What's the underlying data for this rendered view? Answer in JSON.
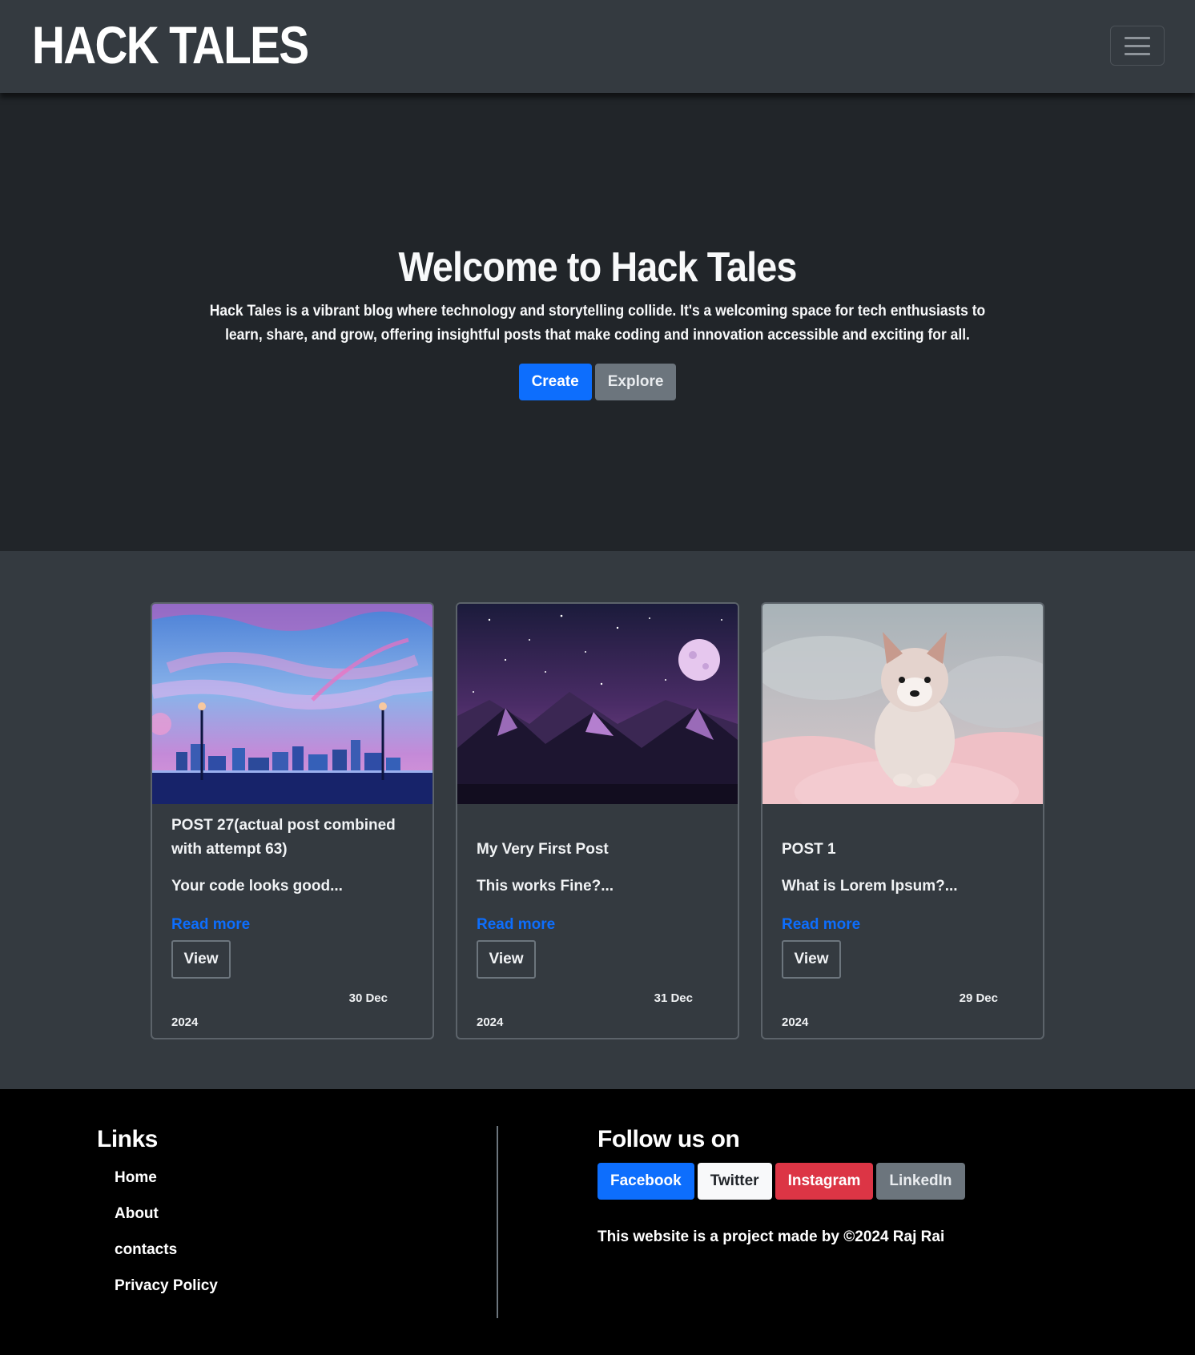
{
  "navbar": {
    "brand": "HACK TALES",
    "toggle_icon": "hamburger-menu-icon"
  },
  "hero": {
    "title": "Welcome to Hack Tales",
    "description": "Hack Tales is a vibrant blog where technology and storytelling collide. It's a welcoming space for tech enthusiasts to learn, share, and grow, offering insightful posts that make coding and innovation accessible and exciting for all.",
    "create_label": "Create",
    "explore_label": "Explore"
  },
  "posts": [
    {
      "image": "city-sunset-illustration",
      "title": "POST 27(actual post combined with attempt 63)",
      "excerpt": "Your code looks good...",
      "read_more": "Read more",
      "view": "View",
      "date_day": "30 Dec",
      "date_year": "2024"
    },
    {
      "image": "night-mountains-illustration",
      "title": "My Very First Post",
      "excerpt": "This works Fine?...",
      "read_more": "Read more",
      "view": "View",
      "date_day": "31 Dec",
      "date_year": "2024"
    },
    {
      "image": "husky-puppy-on-clouds",
      "title": "POST 1",
      "excerpt": "What is Lorem Ipsum?...",
      "read_more": "Read more",
      "view": "View",
      "date_day": "29 Dec",
      "date_year": "2024"
    }
  ],
  "footer": {
    "links_heading": "Links",
    "links": [
      "Home",
      "About",
      "contacts",
      "Privacy Policy"
    ],
    "follow_heading": "Follow us on",
    "social": [
      "Facebook",
      "Twitter",
      "Instagram",
      "LinkedIn"
    ],
    "credit": "This website is a project made by ©2024 Raj Rai"
  },
  "colors": {
    "primary": "#0d6efd",
    "secondary": "#6c757d",
    "danger": "#dc3545",
    "dark": "#212529",
    "navbar": "#343a40"
  }
}
